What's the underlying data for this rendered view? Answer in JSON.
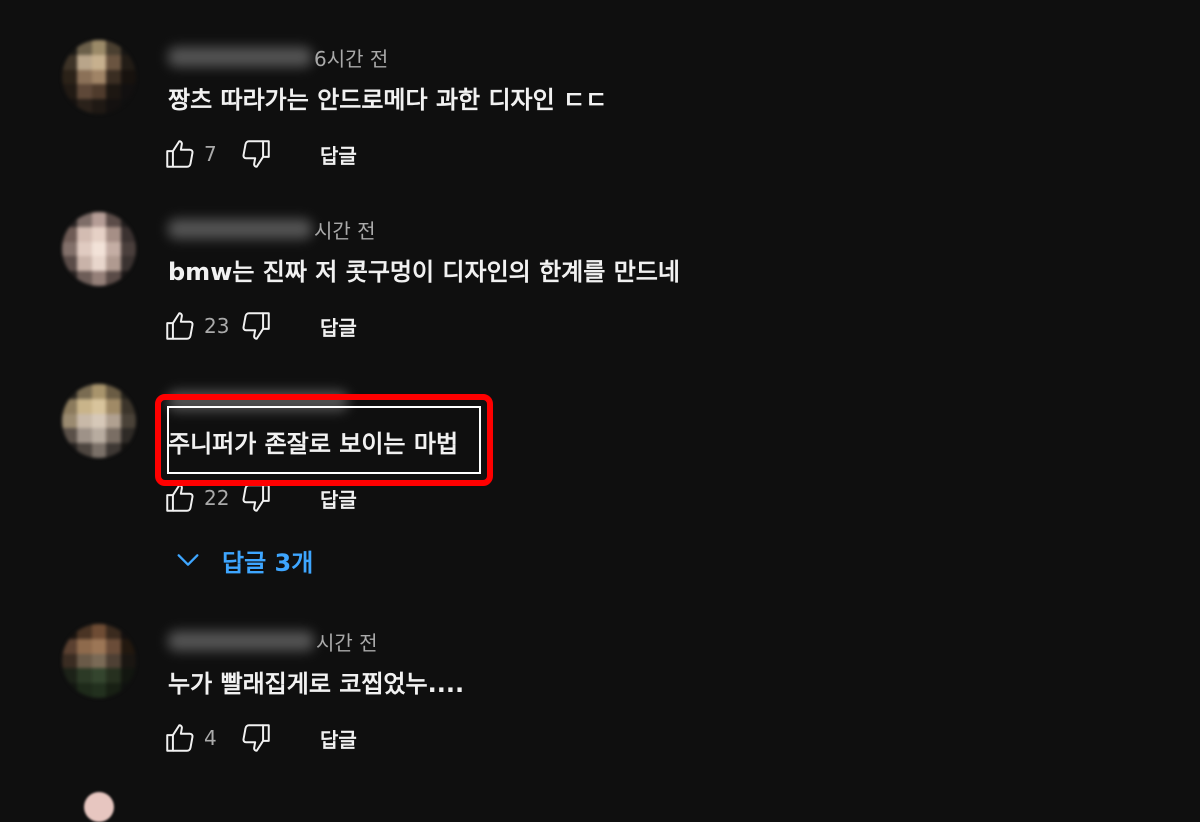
{
  "comments": [
    {
      "time": "6시간 전",
      "text": "짱츠 따라가는 안드로메다 과한 디자인 ㄷㄷ",
      "likes": "7",
      "reply_label": "답글",
      "avatar_colors": [
        "#1c1a16",
        "#6b5f4a",
        "#9b8a68",
        "#4a3f30",
        "#181614",
        "#3d3327",
        "#b9a58a",
        "#c7b08e",
        "#6a5440",
        "#221c16",
        "#2b2218",
        "#8b7158",
        "#a08466",
        "#3a2d22",
        "#17120e",
        "#211a14",
        "#5e4838",
        "#4f3b2c",
        "#1d1712",
        "#121010",
        "#161210",
        "#2a211a",
        "#1f1914",
        "#141110",
        "#101010"
      ]
    },
    {
      "time": "시간 전",
      "text": "bmw는 진짜 저 콧구멍이 디자인의 한계를 만드네",
      "likes": "23",
      "reply_label": "답글",
      "avatar_colors": [
        "#2a2424",
        "#7e6d68",
        "#b59d96",
        "#5b4c48",
        "#221e1e",
        "#6e5b55",
        "#d3bcb2",
        "#e6d1c6",
        "#a68f86",
        "#3a3130",
        "#82706a",
        "#e0cbc1",
        "#f2e2d8",
        "#c4ad a4",
        "#4a3f3c",
        "#5a4c48",
        "#c9b3a9",
        "#e8d6cc",
        "#b09a90",
        "#3a3230",
        "#2a2423",
        "#6d5d58",
        "#958079",
        "#5a4b47",
        "#1c1818"
      ]
    },
    {
      "time": "",
      "text": "주니퍼가 존잘로 보이는 마법",
      "likes": "22",
      "reply_label": "답글",
      "highlighted": true,
      "avatar_colors": [
        "#2a2620",
        "#7a6c52",
        "#a8946c",
        "#6a5c44",
        "#25221c",
        "#8b7a5c",
        "#c9b48a",
        "#d8c49c",
        "#a08a66",
        "#3b342a",
        "#9a8a70",
        "#c8b9a8",
        "#d6c8b8",
        "#b0a090",
        "#4a4238",
        "#5a5048",
        "#9e9288",
        "#b8aca0",
        "#7a6e64",
        "#2e2a26",
        "#262220",
        "#4e4640",
        "#7a7068",
        "#3e3834",
        "#161412"
      ]
    },
    {
      "time": "시간 전",
      "text": "누가 빨래집게로 코찝었누....",
      "likes": "4",
      "reply_label": "답글",
      "avatar_colors": [
        "#1a1410",
        "#4a3424",
        "#6e4c34",
        "#3a2a1e",
        "#141010",
        "#5a4030",
        "#8e6a4c",
        "#9c7656",
        "#6a4c38",
        "#22180f",
        "#3a2c22",
        "#6a5a48",
        "#7a6a56",
        "#4e4034",
        "#1a1612",
        "#1c2218",
        "#2c3a26",
        "#34452e",
        "#26301f",
        "#121610",
        "#141812",
        "#1e2a1a",
        "#22301e",
        "#182014",
        "#101210"
      ]
    }
  ],
  "view_replies": {
    "label": "답글 3개",
    "accent": "#3ea6ff"
  },
  "colors": {
    "background": "#0f0f0f",
    "highlight_border": "#ff0000"
  },
  "icons": [
    "like-icon",
    "dislike-icon",
    "chevron-down-icon"
  ]
}
